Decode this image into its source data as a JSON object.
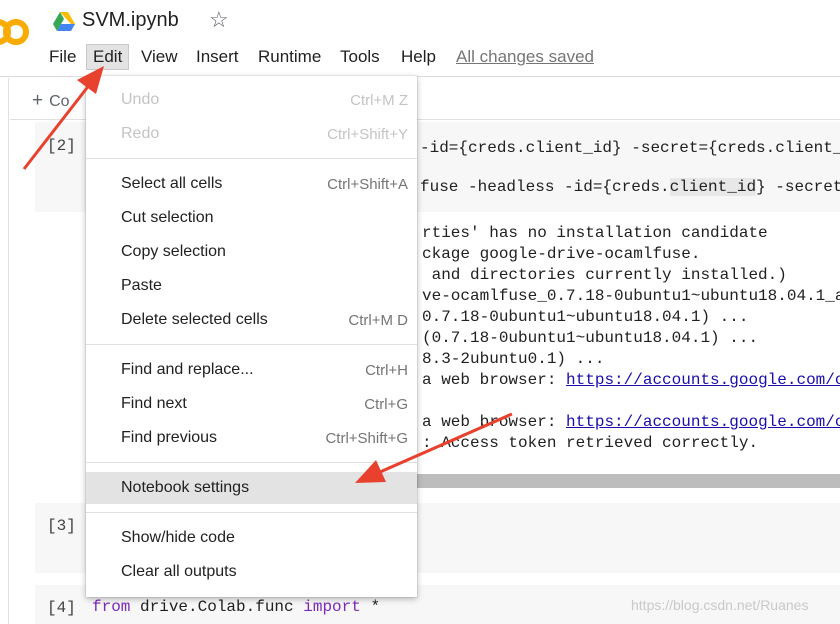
{
  "header": {
    "title": "SVM.ipynb",
    "star_glyph": "☆",
    "saved_status": "All changes saved"
  },
  "menubar": {
    "items": [
      "File",
      "Edit",
      "View",
      "Insert",
      "Runtime",
      "Tools",
      "Help"
    ]
  },
  "toolbar": {
    "add_code_plus": "+",
    "add_code_label": "Co"
  },
  "cells": {
    "cell2": {
      "prompt": "[2]",
      "line1": "-id={creds.client_id} -secret={creds.client_",
      "line2_pre": "fuse -headless -id={creds.",
      "line2_hl": "client_id",
      "line2_post": "} -secret"
    },
    "output": {
      "lines": [
        "rties' has no installation candidate",
        "ckage google-drive-ocamlfuse.",
        " and directories currently installed.)",
        "ve-ocamlfuse_0.7.18-0ubuntu1~ubuntu18.04.1_a",
        "0.7.18-0ubuntu1~ubuntu18.04.1) ...",
        "(0.7.18-0ubuntu1~ubuntu18.04.1) ...",
        "8.3-2ubuntu0.1) ..."
      ],
      "browser_line1_pre": "a web browser: ",
      "browser_line1_link": "https://accounts.google.com/o",
      "browser_line2_pre": "a web browser: ",
      "browser_line2_link": "https://accounts.google.com/o",
      "token_line": ": Access token retrieved correctly."
    },
    "cell3": {
      "prompt": "[3]"
    },
    "cell4": {
      "prompt": "[4]",
      "kw_from": "from",
      "module": " drive.Colab.func ",
      "kw_import": "import",
      "star": " *"
    }
  },
  "edit_menu": {
    "undo": {
      "label": "Undo",
      "shortcut": "Ctrl+M Z"
    },
    "redo": {
      "label": "Redo",
      "shortcut": "Ctrl+Shift+Y"
    },
    "select_all": {
      "label": "Select all cells",
      "shortcut": "Ctrl+Shift+A"
    },
    "cut": {
      "label": "Cut selection",
      "shortcut": ""
    },
    "copy": {
      "label": "Copy selection",
      "shortcut": ""
    },
    "paste": {
      "label": "Paste",
      "shortcut": ""
    },
    "delete": {
      "label": "Delete selected cells",
      "shortcut": "Ctrl+M D"
    },
    "find_replace": {
      "label": "Find and replace...",
      "shortcut": "Ctrl+H"
    },
    "find_next": {
      "label": "Find next",
      "shortcut": "Ctrl+G"
    },
    "find_prev": {
      "label": "Find previous",
      "shortcut": "Ctrl+Shift+G"
    },
    "notebook_settings": {
      "label": "Notebook settings",
      "shortcut": ""
    },
    "show_hide": {
      "label": "Show/hide code",
      "shortcut": ""
    },
    "clear_outputs": {
      "label": "Clear all outputs",
      "shortcut": ""
    }
  },
  "watermark": "https://blog.csdn.net/Ruanes",
  "colors": {
    "annotation_arrow": "#e8412e",
    "colab_logo": "#f9ab00",
    "link": "#1a0dab",
    "keyword": "#7d28b8"
  }
}
